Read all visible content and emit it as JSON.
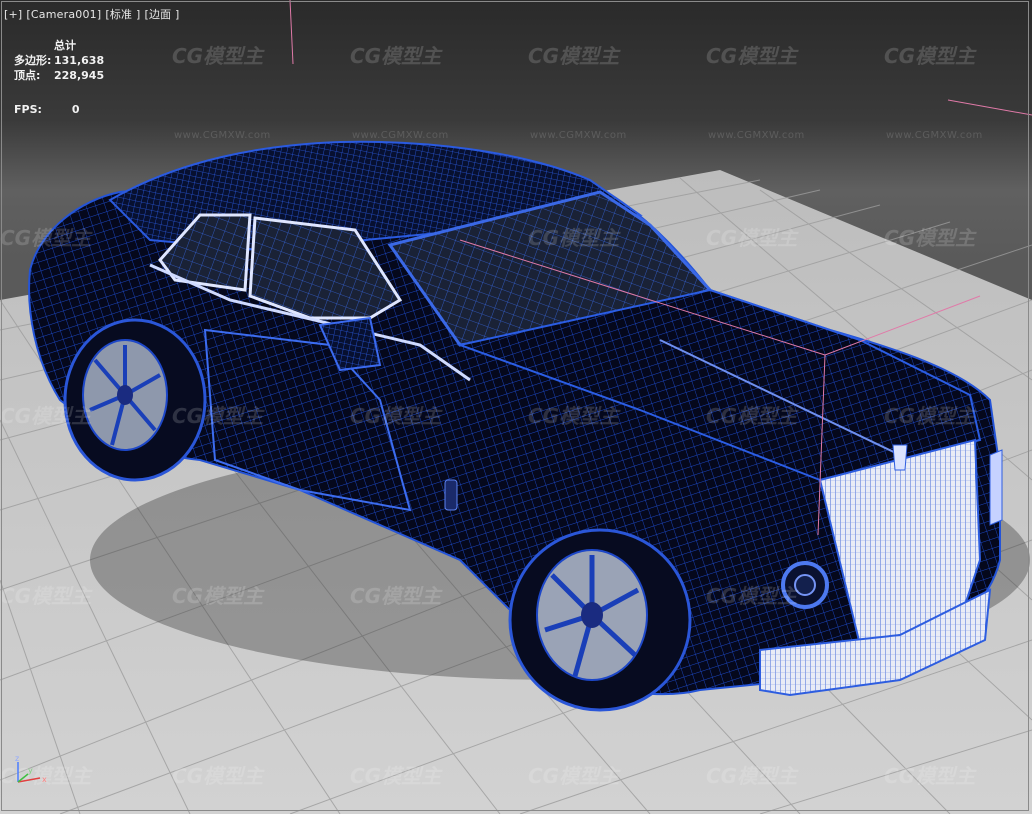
{
  "viewport": {
    "label_parts": [
      "[+]",
      "[Camera001]",
      "[标准 ]",
      "[边面 ]"
    ]
  },
  "stats": {
    "total_label": "总计",
    "polygons_label": "多边形:",
    "polygons_value": "131,638",
    "vertices_label": "顶点:",
    "vertices_value": "228,945",
    "fps_label": "FPS:",
    "fps_value": "0"
  },
  "watermark": {
    "brand": "CG模型主",
    "url": "www.CGMXW.com"
  },
  "axis_labels": {
    "z": "z",
    "y": "y",
    "x": "x"
  },
  "colors": {
    "wire": "#1d4fd6",
    "floor": "#c8c8c8",
    "grid": "#9a9a9a",
    "body": "#060a22",
    "selection": "#e07aa8"
  }
}
